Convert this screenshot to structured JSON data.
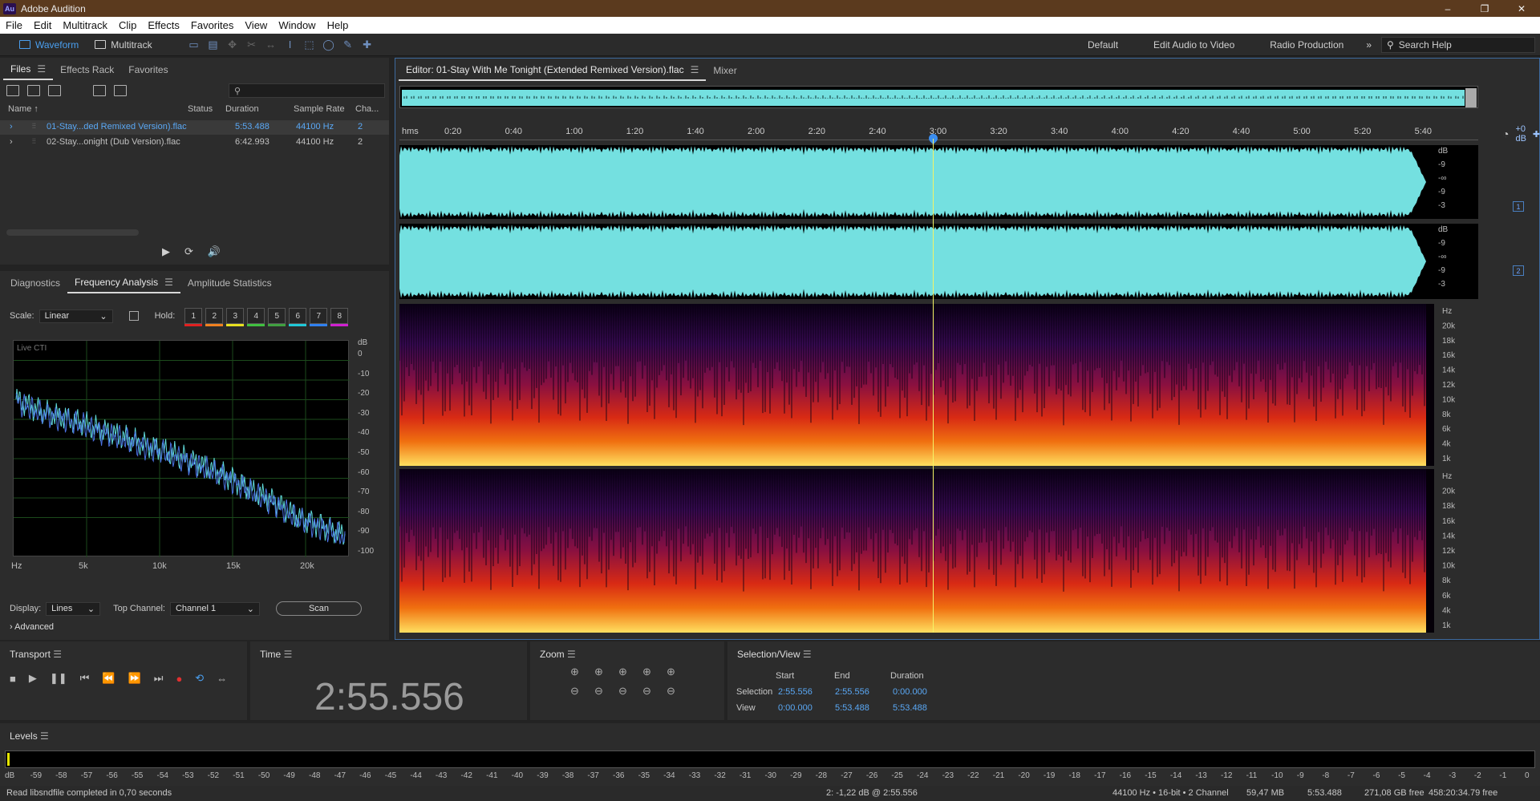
{
  "app": {
    "title": "Adobe Audition",
    "logo_text": "Au"
  },
  "window_controls": {
    "minimize": "–",
    "restore": "❐",
    "close": "✕"
  },
  "menu": [
    "File",
    "Edit",
    "Multitrack",
    "Clip",
    "Effects",
    "Favorites",
    "View",
    "Window",
    "Help"
  ],
  "toolbar": {
    "waveform": "Waveform",
    "multitrack": "Multitrack"
  },
  "workspaces": [
    "Default",
    "Edit Audio to Video",
    "Radio Production"
  ],
  "workspace_more": "»",
  "search_help": "Search Help",
  "files_panel": {
    "tabs": [
      "Files",
      "Effects Rack",
      "Favorites"
    ],
    "search_placeholder": "",
    "search_glyph": "⚲",
    "columns": {
      "name": "Name ↑",
      "status": "Status",
      "duration": "Duration",
      "sample_rate": "Sample Rate",
      "channels": "Cha..."
    },
    "rows": [
      {
        "arrow": "›",
        "name": "01-Stay...ded Remixed Version).flac",
        "duration": "5:53.488",
        "sample_rate": "44100 Hz",
        "channels": "2"
      },
      {
        "arrow": "›",
        "name": "02-Stay...onight (Dub Version).flac",
        "duration": "6:42.993",
        "sample_rate": "44100 Hz",
        "channels": "2"
      }
    ]
  },
  "analysis_panel": {
    "tabs": [
      "Diagnostics",
      "Frequency Analysis",
      "Amplitude Statistics"
    ],
    "scale_label": "Scale:",
    "scale_value": "Linear",
    "hold_label": "Hold:",
    "hold_buttons": [
      "1",
      "2",
      "3",
      "4",
      "5",
      "6",
      "7",
      "8"
    ],
    "hold_colors": [
      "#e02020",
      "#f08020",
      "#e8e020",
      "#40c040",
      "#40a040",
      "#20c8d8",
      "#3080f0",
      "#d020d0"
    ],
    "plot_label": "Live CTI",
    "db_unit": "dB",
    "db_ticks": [
      "0",
      "-10",
      "-20",
      "-30",
      "-40",
      "-50",
      "-60",
      "-70",
      "-80",
      "-90",
      "-100"
    ],
    "hz_ticks": [
      "Hz",
      "5k",
      "10k",
      "15k",
      "20k"
    ],
    "display_label": "Display:",
    "display_value": "Lines",
    "top_channel_label": "Top Channel:",
    "top_channel_value": "Channel 1",
    "scan_button": "Scan",
    "advanced": "Advanced",
    "spectrum_db": [
      -24,
      -30,
      -33,
      -37,
      -41,
      -45,
      -49,
      -53,
      -58,
      -63,
      -70,
      -76,
      -84,
      -88,
      -93
    ]
  },
  "editor": {
    "tabs": [
      "Editor: 01-Stay With Me Tonight (Extended Remixed Version).flac",
      "Mixer"
    ],
    "ruler_labels": [
      "hms",
      "0:20",
      "0:40",
      "1:00",
      "1:20",
      "1:40",
      "2:00",
      "2:20",
      "2:40",
      "3:00",
      "3:20",
      "3:40",
      "4:00",
      "4:20",
      "4:40",
      "5:00",
      "5:20",
      "5:40"
    ],
    "hud_volume": "+0 dB",
    "wave_ticks": [
      "dB",
      "-9",
      "-∞",
      "-9",
      "-3"
    ],
    "channel_badges": [
      "1",
      "2"
    ],
    "spec_ticks": [
      "Hz",
      "20k",
      "18k",
      "16k",
      "14k",
      "12k",
      "10k",
      "8k",
      "6k",
      "4k",
      "1k"
    ],
    "colors": {
      "waveform": "#74e0e0",
      "playhead": "#f4f466",
      "accent": "#4a9ff0"
    }
  },
  "transport": {
    "title": "Transport",
    "buttons": [
      "■",
      "▶",
      "❚❚",
      "⏮",
      "⏪",
      "⏩",
      "⏭",
      "●",
      "⟲",
      "⇔"
    ]
  },
  "time": {
    "title": "Time",
    "value": "2:55.556"
  },
  "zoom": {
    "title": "Zoom",
    "icons": [
      "⊕",
      "⊕",
      "⊕",
      "⊕",
      "⊕",
      "⊖",
      "⊖",
      "⊖",
      "⊖",
      "⊖"
    ]
  },
  "selection_view": {
    "title": "Selection/View",
    "headers": [
      "Start",
      "End",
      "Duration"
    ],
    "selection_label": "Selection",
    "view_label": "View",
    "selection": [
      "2:55.556",
      "2:55.556",
      "0:00.000"
    ],
    "view": [
      "0:00.000",
      "5:53.488",
      "5:53.488"
    ]
  },
  "levels": {
    "title": "Levels",
    "scale": [
      "dB",
      "-59",
      "-58",
      "-57",
      "-56",
      "-55",
      "-54",
      "-53",
      "-52",
      "-51",
      "-50",
      "-49",
      "-48",
      "-47",
      "-46",
      "-45",
      "-44",
      "-43",
      "-42",
      "-41",
      "-40",
      "-39",
      "-38",
      "-37",
      "-36",
      "-35",
      "-34",
      "-33",
      "-32",
      "-31",
      "-30",
      "-29",
      "-28",
      "-27",
      "-26",
      "-25",
      "-24",
      "-23",
      "-22",
      "-21",
      "-20",
      "-19",
      "-18",
      "-17",
      "-16",
      "-15",
      "-14",
      "-13",
      "-12",
      "-11",
      "-10",
      "-9",
      "-8",
      "-7",
      "-6",
      "-5",
      "-4",
      "-3",
      "-2",
      "-1",
      "0"
    ]
  },
  "status": {
    "message": "Read libsndfile completed in 0,70 seconds",
    "cursor": "2: -1,22 dB @ 2:55.556",
    "format": "44100 Hz • 16-bit • 2 Channel",
    "size": "59,47 MB",
    "duration": "5:53.488",
    "free": "271,08 GB free",
    "free_time": "458:20:34.79 free"
  }
}
